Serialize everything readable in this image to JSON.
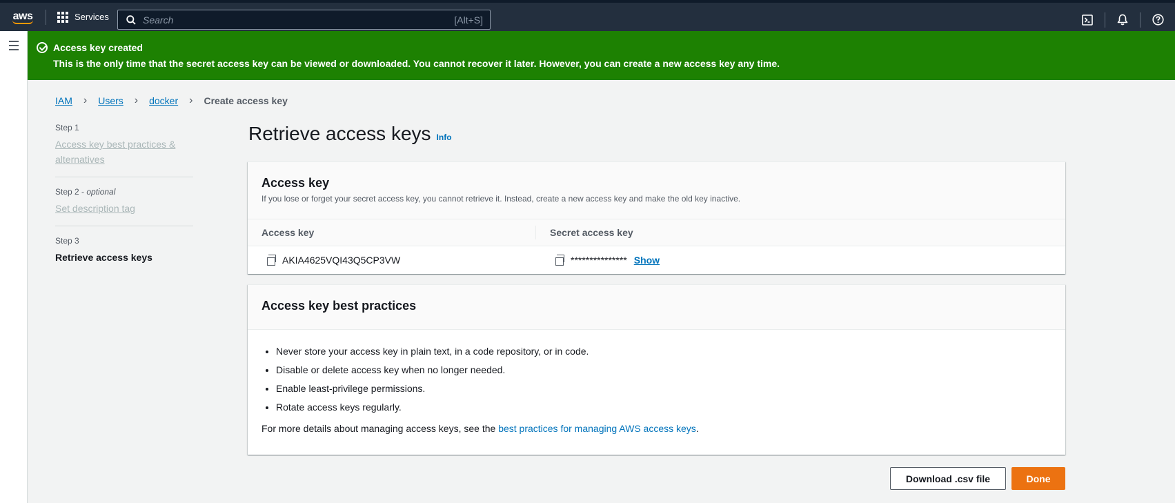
{
  "topnav": {
    "logo": "aws",
    "services_label": "Services",
    "search_placeholder": "Search",
    "search_shortcut": "[Alt+S]",
    "icons": [
      "cloudshell-icon",
      "bell-icon",
      "help-icon"
    ]
  },
  "flash": {
    "title": "Access key created",
    "message": "This is the only time that the secret access key can be viewed or downloaded. You cannot recover it later. However, you can create a new access key any time.",
    "color": "#1d8102"
  },
  "breadcrumb": {
    "items": [
      "IAM",
      "Users",
      "docker"
    ],
    "current": "Create access key"
  },
  "steps": [
    {
      "label": "Step 1",
      "optional": "",
      "name": "Access key best practices & alternatives"
    },
    {
      "label": "Step 2 - ",
      "optional": "optional",
      "name": "Set description tag"
    },
    {
      "label": "Step 3",
      "optional": "",
      "name": "Retrieve access keys"
    }
  ],
  "page": {
    "title": "Retrieve access keys",
    "info": "Info"
  },
  "access_key_panel": {
    "title": "Access key",
    "description": "If you lose or forget your secret access key, you cannot retrieve it. Instead, create a new access key and make the old key inactive.",
    "col_access_key": "Access key",
    "col_secret": "Secret access key",
    "access_key_value": "AKIA4625VQI43Q5CP3VW",
    "secret_masked": "***************",
    "show_label": "Show"
  },
  "best_practices_panel": {
    "title": "Access key best practices",
    "items": [
      "Never store your access key in plain text, in a code repository, or in code.",
      "Disable or delete access key when no longer needed.",
      "Enable least-privilege permissions.",
      "Rotate access keys regularly."
    ],
    "more_prefix": "For more details about managing access keys, see the ",
    "more_link": "best practices for managing AWS access keys",
    "more_suffix": "."
  },
  "buttons": {
    "download_csv": "Download .csv file",
    "done": "Done"
  },
  "colors": {
    "nav_bg": "#232f3e",
    "link": "#0073bb",
    "primary": "#ec7211"
  }
}
